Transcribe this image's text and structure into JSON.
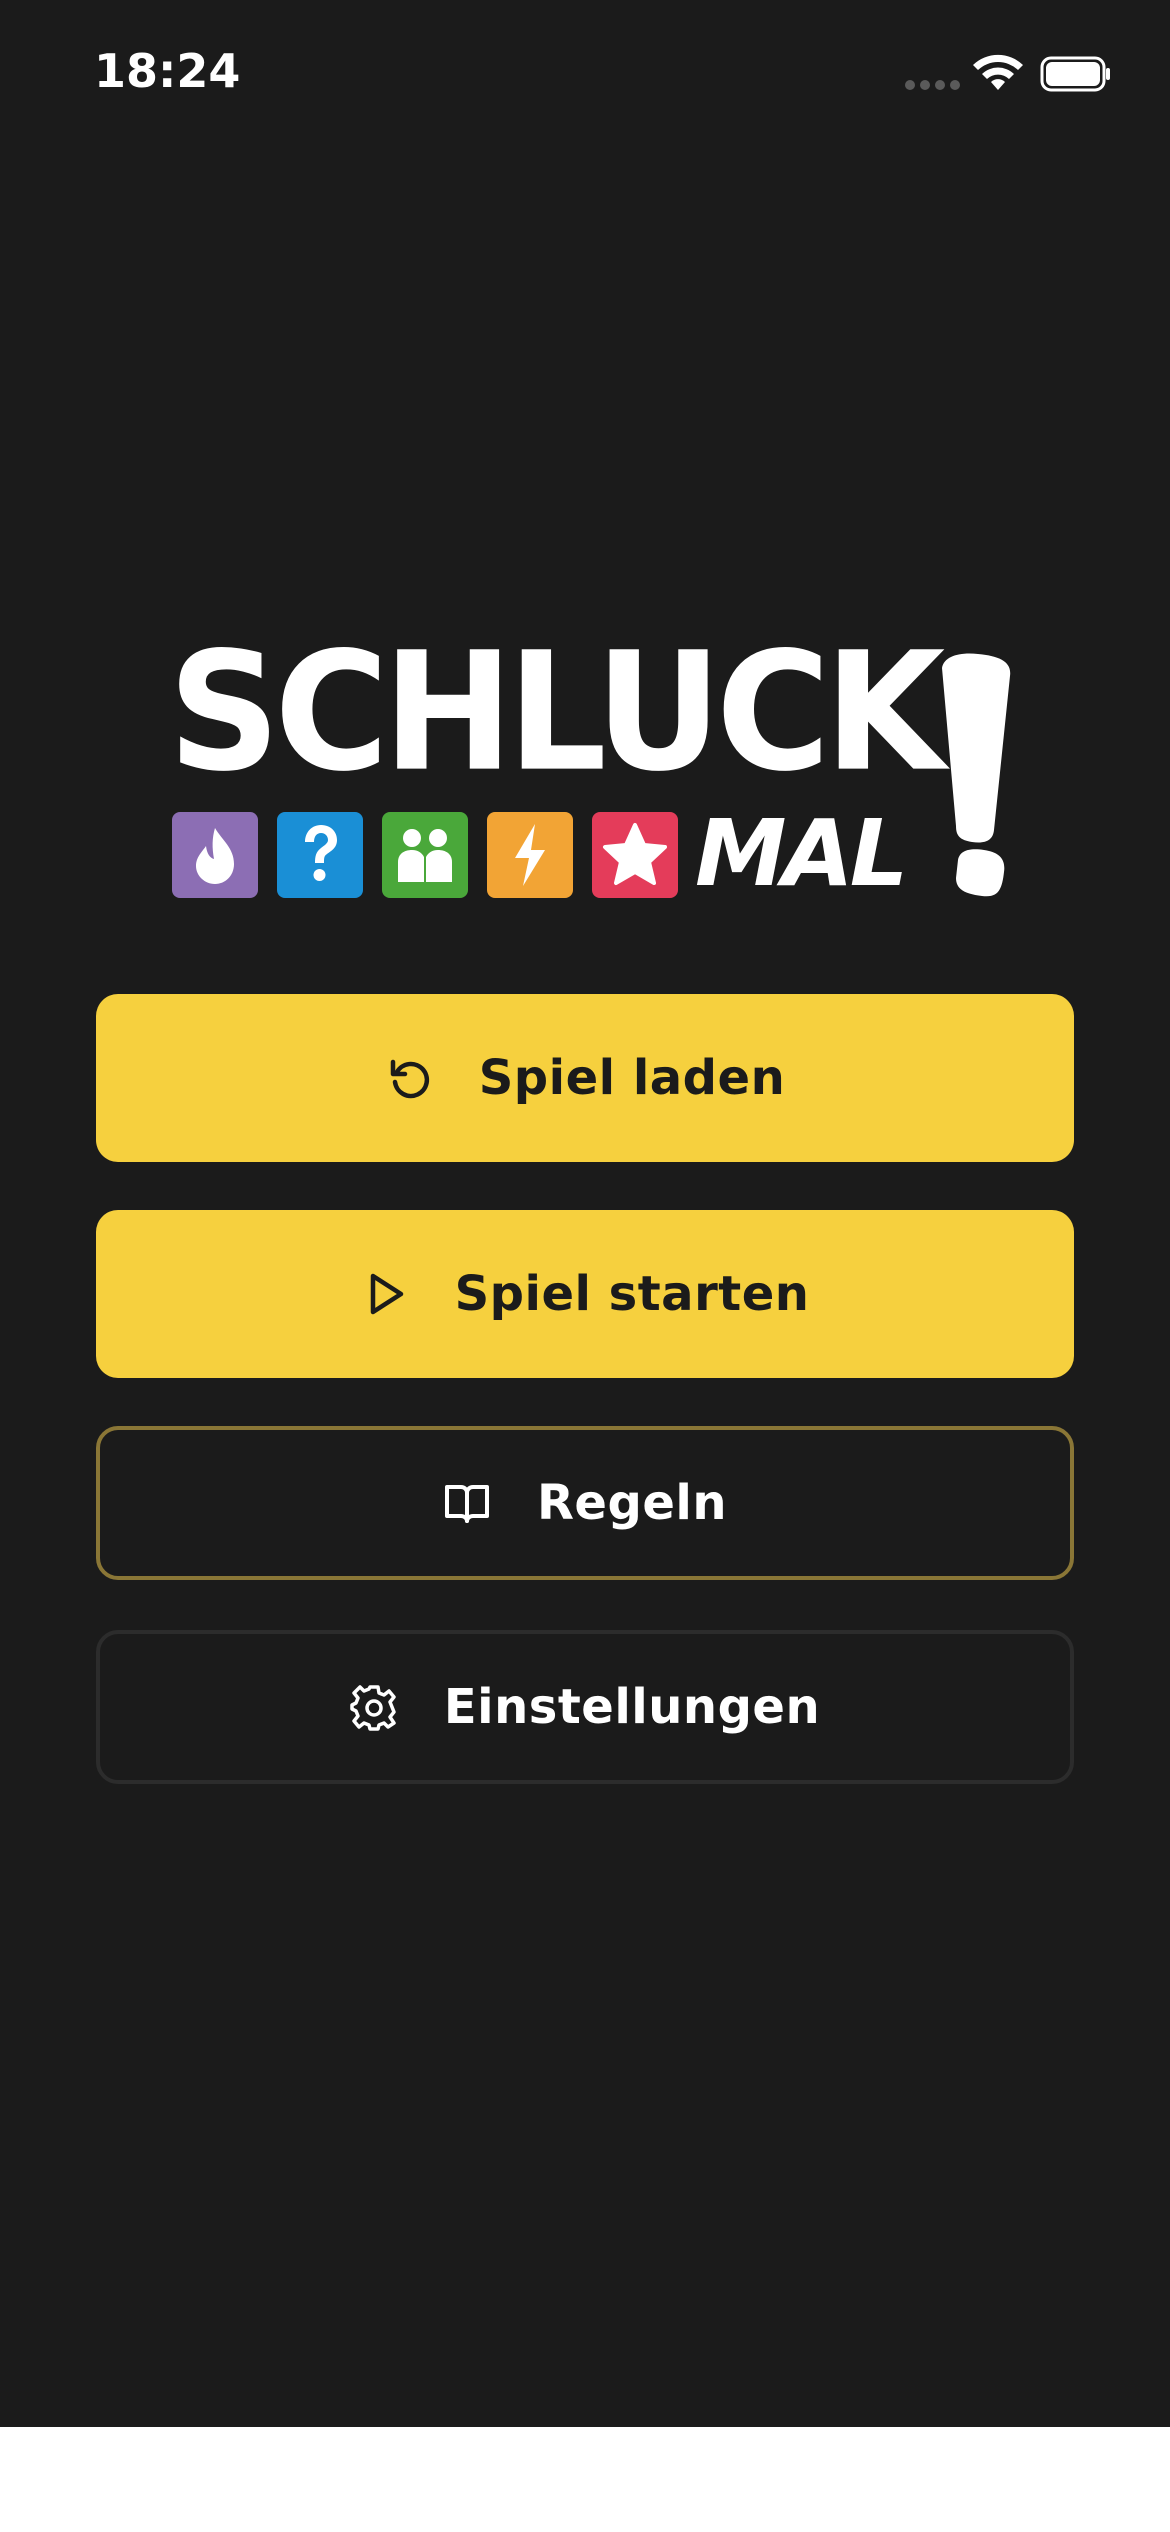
{
  "status_bar": {
    "time": "18:24",
    "signal_icon": "cellular-signal-icon",
    "wifi_icon": "wifi-icon",
    "battery_icon": "battery-icon"
  },
  "logo": {
    "word": "SCHLUCK",
    "mal": "MAL",
    "exclamation": "!",
    "category_icons": [
      {
        "icon": "flame-icon",
        "color": "#8c6eb4"
      },
      {
        "icon": "question-mark-icon",
        "color": "#1a8fd6"
      },
      {
        "icon": "people-icon",
        "color": "#4aa83a"
      },
      {
        "icon": "lightning-icon",
        "color": "#f2a435"
      },
      {
        "icon": "star-icon",
        "color": "#e43c5a"
      }
    ]
  },
  "menu": {
    "load_game": {
      "label": "Spiel laden",
      "icon": "reload-icon"
    },
    "start_game": {
      "label": "Spiel starten",
      "icon": "play-icon"
    },
    "rules": {
      "label": "Regeln",
      "icon": "book-icon"
    },
    "settings": {
      "label": "Einstellungen",
      "icon": "gear-icon"
    }
  },
  "colors": {
    "background": "#1b1b1b",
    "accent": "#f6d03e",
    "gold_border": "#8a7636",
    "dark_border": "#2c2c2c"
  }
}
